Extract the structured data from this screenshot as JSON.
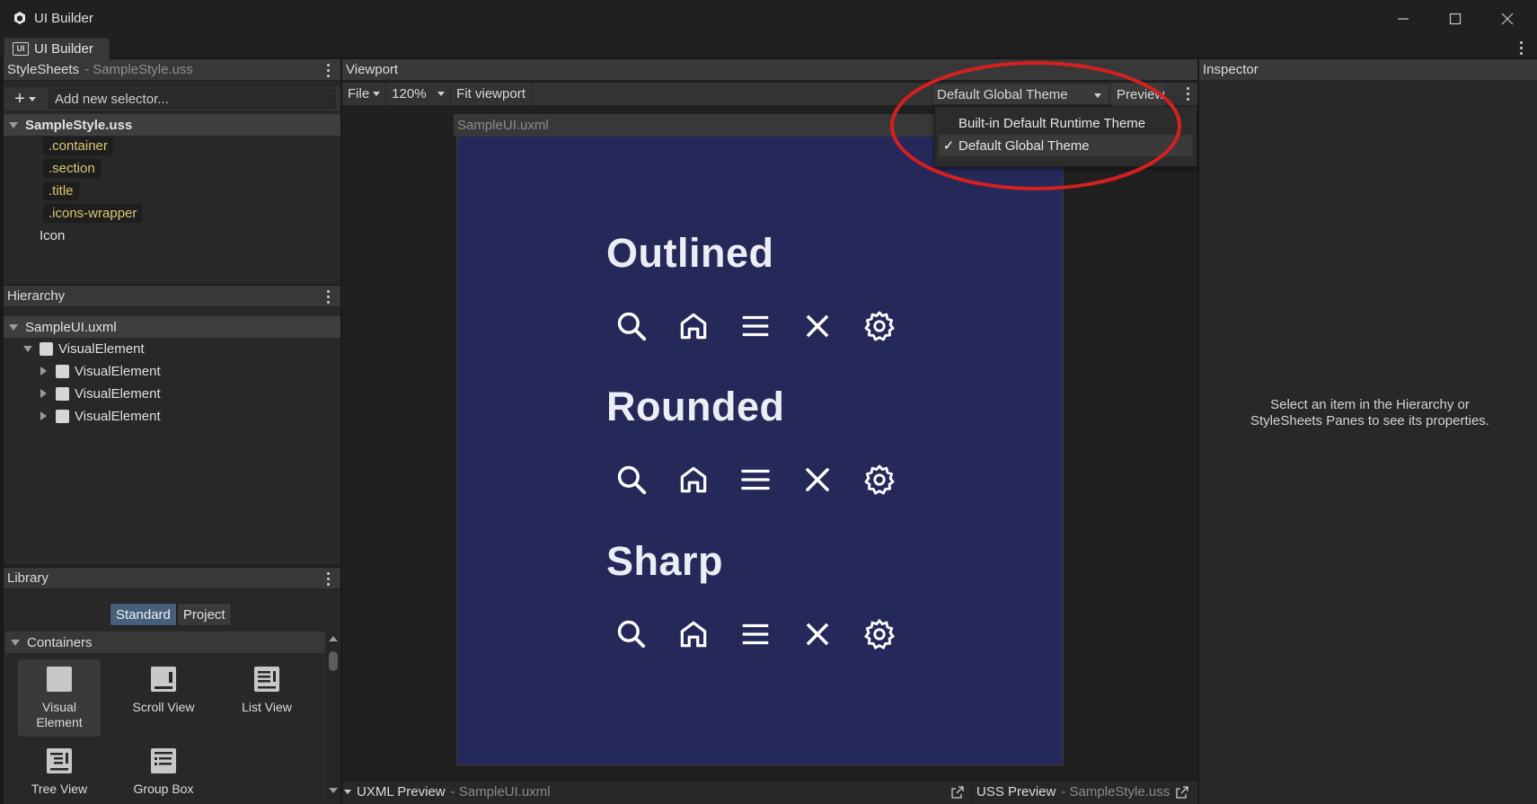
{
  "window": {
    "title": "UI Builder",
    "tab_label": "UI Builder",
    "controls": [
      "minimize",
      "maximize",
      "close"
    ]
  },
  "stylesheets": {
    "header_label": "StyleSheets",
    "header_file": "- SampleStyle.uss",
    "selector_placeholder": "Add new selector...",
    "root": "SampleStyle.uss",
    "selectors": [
      ".container",
      ".section",
      ".title",
      ".icons-wrapper"
    ],
    "extra_item": "Icon"
  },
  "hierarchy": {
    "header_label": "Hierarchy",
    "root": "SampleUI.uxml",
    "items": [
      {
        "label": "VisualElement",
        "level": 0
      },
      {
        "label": "VisualElement",
        "level": 1
      },
      {
        "label": "VisualElement",
        "level": 1
      },
      {
        "label": "VisualElement",
        "level": 1
      }
    ]
  },
  "library": {
    "header_label": "Library",
    "tabs": [
      "Standard",
      "Project"
    ],
    "active_tab": "Standard",
    "section_label": "Containers",
    "items": [
      {
        "label": "Visual Element",
        "icon": "visual-element-icon"
      },
      {
        "label": "Scroll View",
        "icon": "scroll-view-icon"
      },
      {
        "label": "List View",
        "icon": "list-view-icon"
      },
      {
        "label": "Tree View",
        "icon": "tree-view-icon"
      },
      {
        "label": "Group Box",
        "icon": "group-box-icon"
      }
    ]
  },
  "viewport": {
    "header_label": "Viewport",
    "file_menu": "File",
    "zoom": "120%",
    "fit_label": "Fit viewport",
    "theme_selected": "Default Global Theme",
    "preview_label": "Preview",
    "document_tab": "SampleUI.uxml",
    "theme_menu": [
      {
        "label": "Built-in Default Runtime Theme",
        "checked": false
      },
      {
        "label": "Default Global Theme",
        "checked": true
      }
    ],
    "canvas_bg": "#25295a",
    "sections": [
      {
        "title": "Outlined",
        "icons": [
          "search-icon",
          "home-icon",
          "menu-icon",
          "close-icon",
          "settings-icon"
        ]
      },
      {
        "title": "Rounded",
        "icons": [
          "search-icon",
          "home-icon",
          "menu-icon",
          "close-icon",
          "settings-icon"
        ]
      },
      {
        "title": "Sharp",
        "icons": [
          "search-icon",
          "home-icon",
          "menu-icon",
          "close-icon",
          "settings-icon"
        ]
      }
    ]
  },
  "bottom": {
    "uxml_label": "UXML Preview",
    "uxml_file": "- SampleUI.uxml",
    "uss_label": "USS Preview",
    "uss_file": "- SampleStyle.uss"
  },
  "inspector": {
    "header_label": "Inspector",
    "message": "Select an item in the Hierarchy or StyleSheets Panes to see its properties."
  },
  "colors": {
    "annotation_ellipse": "#d42020",
    "selector_text": "#d9c873",
    "active_tab": "#46607c"
  }
}
